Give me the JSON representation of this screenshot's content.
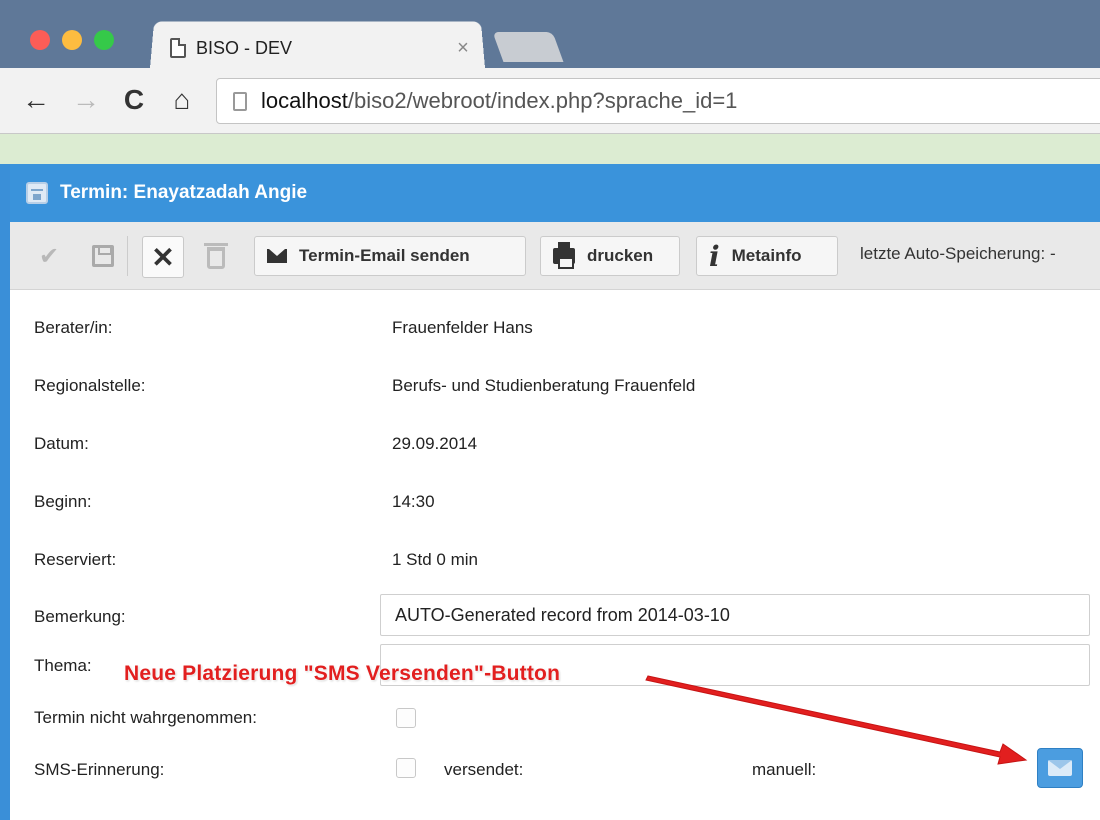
{
  "browser": {
    "tab_title": "BISO - DEV",
    "tab_close": "×",
    "url_host": "localhost",
    "url_path": "/biso2/webroot/index.php?sprache_id=1"
  },
  "dialog": {
    "title": "Termin: Enayatzadah Angie"
  },
  "toolbar": {
    "email_label": "Termin-Email senden",
    "print_label": "drucken",
    "meta_label": "Metainfo",
    "autosave_label": "letzte Auto-Speicherung: -"
  },
  "form": {
    "berater_label": "Berater/in:",
    "berater_value": "Frauenfelder Hans",
    "regional_label": "Regionalstelle:",
    "regional_value": "Berufs- und Studienberatung Frauenfeld",
    "datum_label": "Datum:",
    "datum_value": "29.09.2014",
    "beginn_label": "Beginn:",
    "beginn_value": "14:30",
    "reserviert_label": "Reserviert:",
    "reserviert_value": "1 Std 0 min",
    "bemerkung_label": "Bemerkung:",
    "bemerkung_value": "AUTO-Generated record from 2014-03-10",
    "thema_label": "Thema:",
    "thema_value": "",
    "nicht_wahrgenommen_label": "Termin nicht wahrgenommen:",
    "nicht_wahrgenommen_checked": false,
    "sms_label": "SMS-Erinnerung:",
    "sms_checked": false,
    "versendet_label": "versendet:",
    "manuell_label": "manuell:"
  },
  "annotation": {
    "text": "Neue Platzierung \"SMS Versenden\"-Button",
    "color": "#e21f1f"
  },
  "colors": {
    "header_blue": "#3a93db",
    "sms_button": "#4b9de0"
  }
}
